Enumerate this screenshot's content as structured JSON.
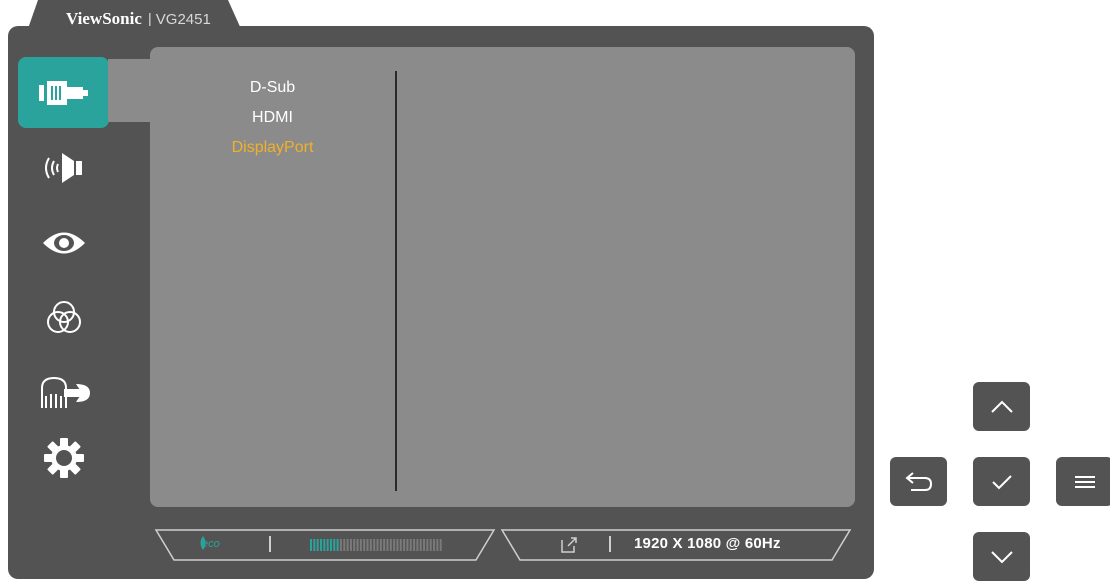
{
  "header": {
    "brand": "ViewSonic",
    "separator": "|",
    "model": "VG2451"
  },
  "sidebar": {
    "items": [
      {
        "name": "input-select",
        "icon": "input-connector-icon",
        "active": true
      },
      {
        "name": "audio",
        "icon": "speaker-icon",
        "active": false
      },
      {
        "name": "view-mode",
        "icon": "eye-icon",
        "active": false
      },
      {
        "name": "color",
        "icon": "color-circles-icon",
        "active": false
      },
      {
        "name": "manual-adjust",
        "icon": "hand-wrench-icon",
        "active": false
      },
      {
        "name": "setup",
        "icon": "gear-icon",
        "active": false
      }
    ]
  },
  "input_list": {
    "items": [
      {
        "label": "D-Sub",
        "selected": false
      },
      {
        "label": "HDMI",
        "selected": false
      },
      {
        "label": "DisplayPort",
        "selected": true
      }
    ]
  },
  "status_bar": {
    "eco_label": "eco",
    "eco_meter_fraction": 0.23,
    "resolution": "1920 X 1080 @ 60Hz"
  },
  "buttons": {
    "up": "chevron-up-icon",
    "back": "return-arrow-icon",
    "ok": "checkmark-icon",
    "menu": "menu-icon",
    "down": "chevron-down-icon"
  },
  "colors": {
    "accent": "#2aa39d",
    "selected_text": "#f0b12a",
    "frame": "#535353",
    "panel": "#8c8b8b"
  }
}
